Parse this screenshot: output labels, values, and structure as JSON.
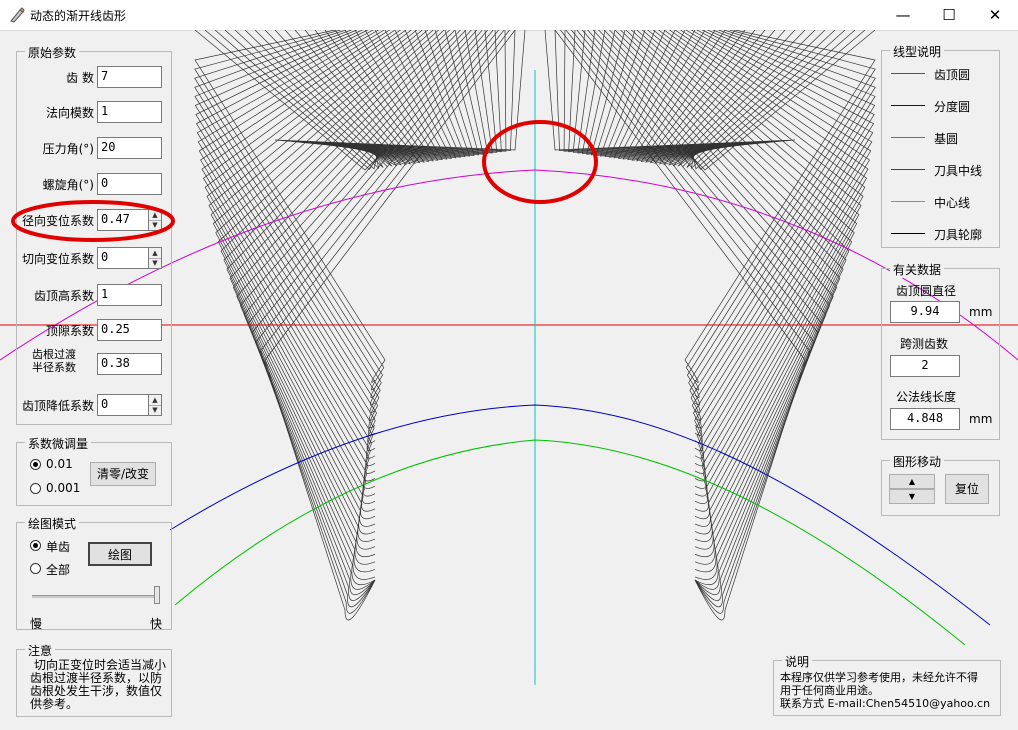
{
  "window": {
    "title": "动态的渐开线齿形",
    "minimize": "—",
    "maximize": "☐",
    "close": "✕"
  },
  "params": {
    "title": "原始参数",
    "fields": [
      {
        "label": "齿  数",
        "value": "7"
      },
      {
        "label": "法向模数",
        "value": "1"
      },
      {
        "label": "压力角(°)",
        "value": "20"
      },
      {
        "label": "螺旋角(°)",
        "value": "0"
      },
      {
        "label": "径向变位系数",
        "value": "0.47"
      },
      {
        "label": "切向变位系数",
        "value": "0"
      },
      {
        "label": "齿顶高系数",
        "value": "1"
      },
      {
        "label": "顶隙系数",
        "value": "0.25"
      },
      {
        "label_line1": "齿根过渡",
        "label_line2": "半径系数",
        "value": "0.38"
      },
      {
        "label": "齿顶降低系数",
        "value": "0"
      }
    ]
  },
  "tune": {
    "title": "系数微调量",
    "options": [
      "0.01",
      "0.001"
    ],
    "selected": "0.01",
    "reset_label": "清零/改变"
  },
  "draw_mode": {
    "title": "绘图模式",
    "options": [
      "单齿",
      "全部"
    ],
    "selected": "单齿",
    "draw_label": "绘图",
    "slow_label": "慢",
    "fast_label": "快",
    "speed": 1.0
  },
  "note": {
    "title": "注意",
    "lines": [
      "切向正变位时会适当减小",
      "齿根过渡半径系数，以防",
      "齿根处发生干涉，数值仅",
      "供参考。"
    ]
  },
  "legend": {
    "title": "线型说明",
    "items": [
      {
        "label": "齿顶圆",
        "color": "#d000d0"
      },
      {
        "label": "分度圆",
        "color": "#0000c0"
      },
      {
        "label": "基圆",
        "color": "#00c000"
      },
      {
        "label": "刀具中线",
        "color": "#e00000"
      },
      {
        "label": "中心线",
        "color": "#00c8c8"
      },
      {
        "label": "刀具轮廓",
        "color": "#000000"
      }
    ]
  },
  "data_panel": {
    "title": "有关数据",
    "tip_dia_label": "齿顶圆直径",
    "tip_dia_value": "9.94",
    "span_teeth_label": "跨测齿数",
    "span_teeth_value": "2",
    "base_tangent_label": "公法线长度",
    "base_tangent_value": "4.848",
    "unit": "mm"
  },
  "move": {
    "title": "图形移动",
    "up": "▲",
    "down": "▼",
    "reset_label": "复位"
  },
  "about": {
    "title": "说明",
    "line1": "本程序仅供学习参考使用，未经允许不得",
    "line2": "用于任何商业用途。",
    "line3": "联系方式 E-mail:Chen54510@yahoo.cn"
  }
}
